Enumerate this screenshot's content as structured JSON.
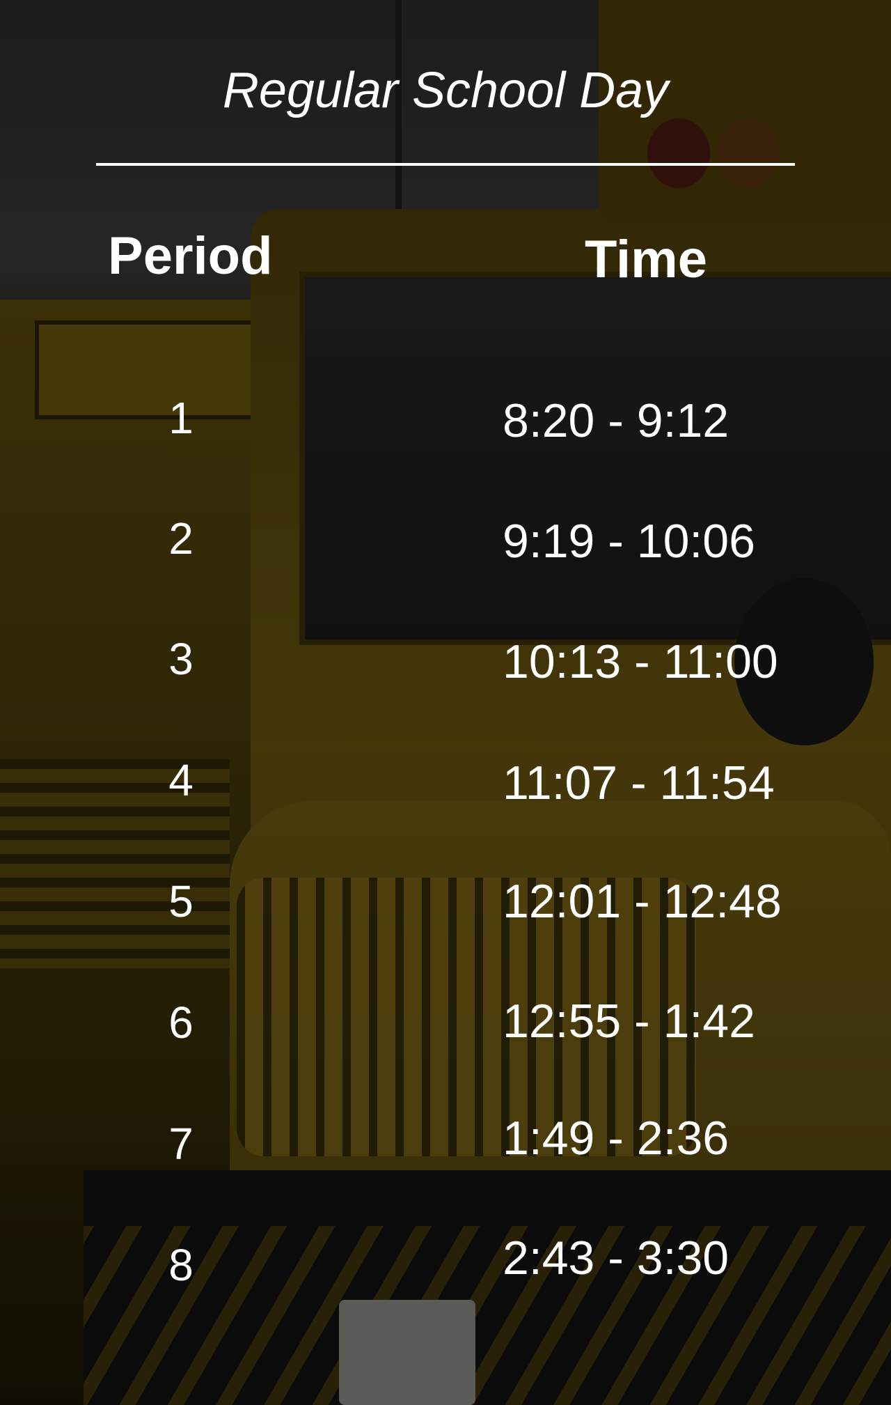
{
  "title": "Regular School Day",
  "headers": {
    "period": "Period",
    "time": "Time"
  },
  "rows": [
    {
      "period": "1",
      "time": "8:20 - 9:12"
    },
    {
      "period": "2",
      "time": "9:19 - 10:06"
    },
    {
      "period": "3",
      "time": "10:13 - 11:00"
    },
    {
      "period": "4",
      "time": "11:07 - 11:54"
    },
    {
      "period": "5",
      "time": "12:01 - 12:48"
    },
    {
      "period": "6",
      "time": "12:55 - 1:42"
    },
    {
      "period": "7",
      "time": "1:49 - 2:36"
    },
    {
      "period": "8",
      "time": "2:43 - 3:30"
    }
  ]
}
